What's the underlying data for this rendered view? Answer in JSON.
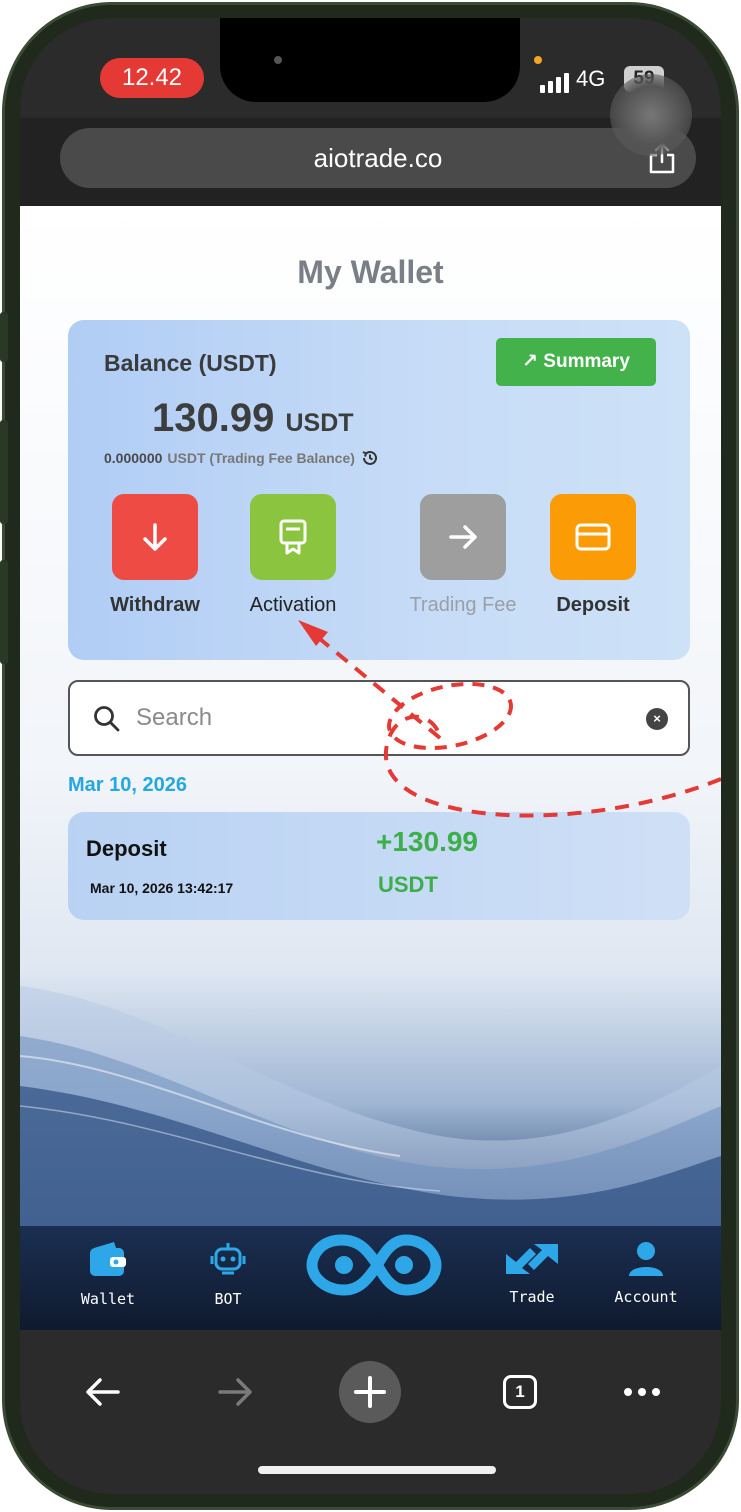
{
  "status_bar": {
    "time": "12.42",
    "network": "4G",
    "battery": "59"
  },
  "browser": {
    "url": "aiotrade.co",
    "tab_count": "1"
  },
  "page": {
    "title": "My Wallet"
  },
  "balance": {
    "label": "Balance (USDT)",
    "summary_button": "Summary",
    "amount": "130.99",
    "unit": "USDT",
    "fee_amount": "0.000000",
    "fee_label": "USDT (Trading Fee Balance)"
  },
  "actions": [
    {
      "label": "Withdraw",
      "color": "#ef4b45",
      "icon": "arrow-down-icon"
    },
    {
      "label": "Activation",
      "color": "#8bc53f",
      "icon": "certificate-icon"
    },
    {
      "label": "Trading Fee",
      "color": "#9e9e9e",
      "icon": "arrow-right-icon"
    },
    {
      "label": "Deposit",
      "color": "#fb9b06",
      "icon": "card-icon"
    }
  ],
  "search": {
    "placeholder": "Search",
    "value": ""
  },
  "transactions": {
    "date_header": "Mar 10, 2026",
    "items": [
      {
        "type": "Deposit",
        "datetime": "Mar 10, 2026   13:42:17",
        "amount": "+130.99",
        "unit": "USDT"
      }
    ]
  },
  "app_nav": {
    "items": [
      {
        "label": "Wallet",
        "icon": "wallet-icon"
      },
      {
        "label": "BOT",
        "icon": "robot-icon"
      },
      {
        "label": "",
        "icon": "logo-link-icon"
      },
      {
        "label": "Trade",
        "icon": "trade-arrows-icon"
      },
      {
        "label": "Account",
        "icon": "account-icon"
      }
    ]
  },
  "colors": {
    "accent_blue": "#25a7e0",
    "green": "#43b24a",
    "annotation_red": "#e53935"
  }
}
